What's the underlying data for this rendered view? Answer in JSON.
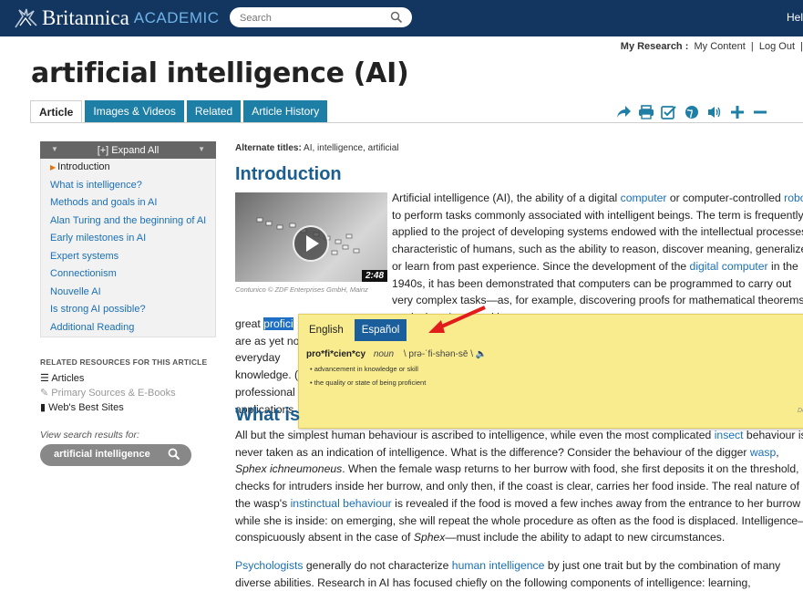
{
  "topbar": {
    "logo_brand": "Britannica",
    "logo_product": "ACADEMIC",
    "search_placeholder": "Search",
    "help_label": "Hel"
  },
  "account": {
    "my_research": "My Research",
    "sep": ":",
    "my_content": "My Content",
    "log_out": "Log Out",
    "pipe": "|"
  },
  "article": {
    "title": "artificial intelligence (AI)",
    "alt_titles_label": "Alternate titles:",
    "alt_titles": "AI, intelligence, artificial"
  },
  "tabs": [
    {
      "label": "Article",
      "active": true
    },
    {
      "label": "Images & Videos",
      "active": false
    },
    {
      "label": "Related",
      "active": false
    },
    {
      "label": "Article History",
      "active": false
    }
  ],
  "tools": [
    "share-icon",
    "print-icon",
    "cite-icon",
    "translate-globe-icon",
    "audio-icon",
    "font-increase-icon",
    "font-decrease-icon"
  ],
  "toc": {
    "expand_label": "[+] Expand All",
    "items": [
      "Introduction",
      "What is intelligence?",
      "Methods and goals in AI",
      "Alan Turing and the beginning of AI",
      "Early milestones in AI",
      "Expert systems",
      "Connectionism",
      "Nouvelle AI",
      "Is strong AI possible?",
      "Additional Reading"
    ]
  },
  "related": {
    "heading": "RELATED RESOURCES FOR THIS ARTICLE",
    "items": [
      "Articles",
      "Primary Sources & E-Books",
      "Web's Best Sites"
    ],
    "view_results": "View search results for:",
    "search_term": "artificial intelligence"
  },
  "intro": {
    "heading": "Introduction",
    "video_duration": "2:48",
    "video_credit": "Contunico © ZDF Enterprises GmbH, Mainz"
  },
  "popup": {
    "lang_en": "English",
    "lang_es": "Español",
    "headword": "pro*fi*cien*cy",
    "pos": "noun",
    "pron": "\\ prə-ˈfi-shən-sē \\",
    "defs": [
      "advancement in knowledge or skill",
      "the quality or state of being proficient"
    ],
    "credit": "De"
  },
  "what": {
    "heading": "What is"
  },
  "colors": {
    "topbar": "#123660",
    "accent_tab": "#1e7fa6",
    "heading_blue": "#1b5e8f",
    "popup_bg": "#f8ec8f"
  }
}
